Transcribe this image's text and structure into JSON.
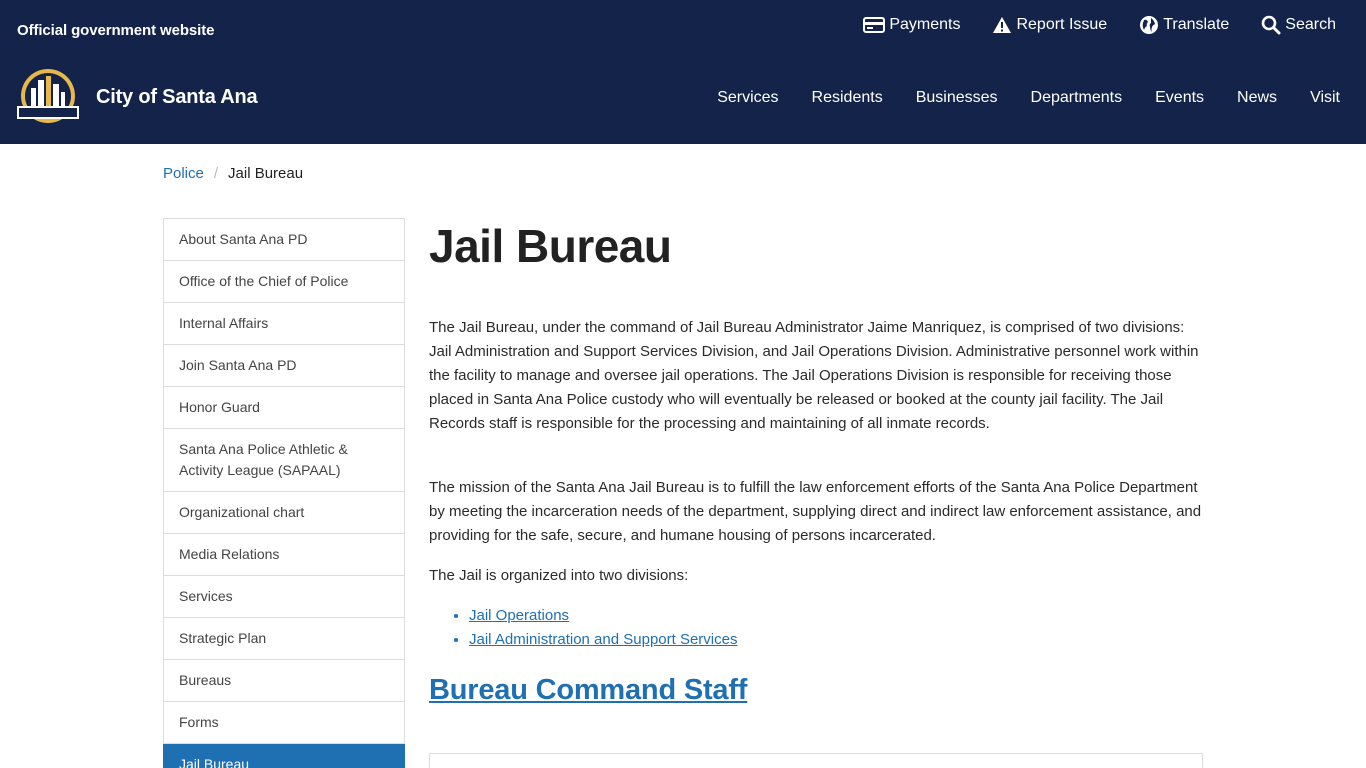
{
  "header": {
    "official_text": "Official government website",
    "site_name": "City of Santa Ana",
    "logo_text": "SANTA ANA",
    "colors": {
      "background": "#13234a",
      "logo_gold": "#e8b84a"
    },
    "utility_links": [
      {
        "label": "Payments",
        "icon": "credit-card-icon"
      },
      {
        "label": "Report Issue",
        "icon": "warning-icon"
      },
      {
        "label": "Translate",
        "icon": "globe-icon"
      },
      {
        "label": "Search",
        "icon": "search-icon"
      }
    ],
    "nav": [
      "Services",
      "Residents",
      "Businesses",
      "Departments",
      "Events",
      "News",
      "Visit"
    ]
  },
  "breadcrumb": {
    "parent": "Police",
    "separator": "/",
    "current": "Jail Bureau"
  },
  "sidebar": {
    "items": [
      "About Santa Ana PD",
      "Office of the Chief of Police",
      "Internal Affairs",
      "Join Santa Ana PD",
      "Honor Guard",
      "Santa Ana Police Athletic & Activity League (SAPAAL)",
      "Organizational chart",
      "Media Relations",
      "Services",
      "Strategic Plan",
      "Bureaus",
      "Forms",
      "Jail Bureau"
    ],
    "active_color": "#1f6fb3"
  },
  "main": {
    "title": "Jail Bureau",
    "paragraphs": [
      "The Jail Bureau, under the command of Jail Bureau Administrator Jaime Manriquez, is comprised of two divisions: Jail Administration and Support Services Division, and Jail Operations Division. Administrative personnel work within the facility to manage and oversee jail operations. The Jail Operations Division is responsible for receiving those placed in Santa Ana Police custody who will eventually be released or booked at the county jail facility. The Jail Records staff is responsible for the processing and maintaining of all inmate records.",
      "The mission of the Santa Ana Jail Bureau is to fulfill the law enforcement efforts of the Santa Ana Police Department by meeting the incarceration needs of the department, supplying direct and indirect law enforcement assistance, and providing for the safe, secure, and humane housing of persons incarcerated.",
      "The Jail is organized into two divisions:"
    ],
    "division_links": [
      "Jail Operations",
      "Jail Administration and Support Services"
    ],
    "section_heading": "Bureau Command Staff",
    "link_color": "#1f6fb3"
  }
}
